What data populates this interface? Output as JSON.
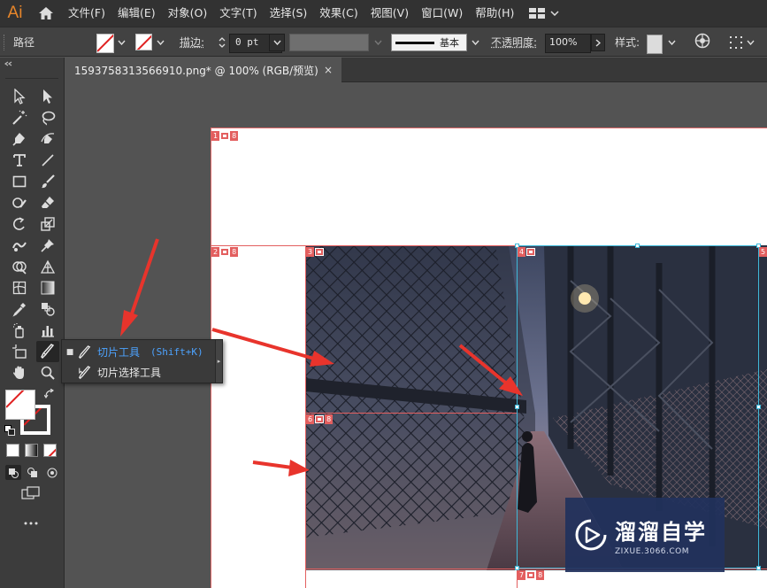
{
  "app": {
    "logo": "Ai",
    "brand_color": "#e8862a"
  },
  "menubar": {
    "items": [
      "文件(F)",
      "编辑(E)",
      "对象(O)",
      "文字(T)",
      "选择(S)",
      "效果(C)",
      "视图(V)",
      "窗口(W)",
      "帮助(H)"
    ]
  },
  "controlbar": {
    "selection_label": "路径",
    "stroke_label": "描边",
    "stroke_value": "0 pt",
    "brush_label": "基本",
    "opacity_label": "不透明度",
    "opacity_value": "100%",
    "style_label": "样式"
  },
  "document": {
    "tab_title": "1593758313566910.png* @ 100% (RGB/预览)",
    "close_glyph": "×"
  },
  "flyout": {
    "items": [
      {
        "label": "切片工具",
        "shortcut": "(Shift+K)",
        "selected": true,
        "icon": "slice-tool-icon"
      },
      {
        "label": "切片选择工具",
        "shortcut": "",
        "selected": false,
        "icon": "slice-select-tool-icon"
      }
    ]
  },
  "slices": [
    {
      "number": "1"
    },
    {
      "number": "2"
    },
    {
      "number": "3"
    },
    {
      "number": "4"
    },
    {
      "number": "5"
    },
    {
      "number": "6"
    },
    {
      "number": "7"
    }
  ],
  "watermark": {
    "name": "溜溜自学",
    "url": "ZIXUE.3066.COM"
  },
  "colors": {
    "slice_line": "#e35f5f",
    "selection": "#3fb8d8",
    "annotation_arrow": "#e8342c",
    "active_tool_text": "#4da3ff"
  }
}
